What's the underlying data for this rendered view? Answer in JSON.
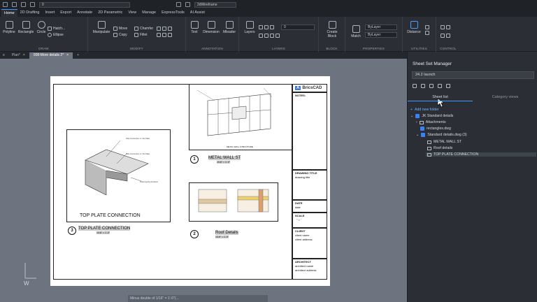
{
  "qat": {
    "layer_combo": "0",
    "workspace_combo": "2dWireframe"
  },
  "menu_tabs": [
    "Home",
    "2D Drafting",
    "Insert",
    "Export",
    "Annotate",
    "2D Parametric",
    "View",
    "Manage",
    "ExpressTools",
    "AI Assist"
  ],
  "ribbon": {
    "draw": {
      "title": "DRAW",
      "polyline": "Polyline",
      "rectangle": "Rectangle",
      "circle": "Circle",
      "hatch": "Hatch...",
      "ellipse": "Ellipse"
    },
    "modify": {
      "title": "MODIFY",
      "manipulate": "Manipulate",
      "move": "Move",
      "copy": "Copy",
      "chamfer": "Chamfer",
      "fillet": "Fillet"
    },
    "annotation": {
      "title": "ANNOTATION",
      "text": "Text",
      "dimension": "Dimension",
      "mleader": "Mleader"
    },
    "layers": {
      "title": "LAYERS",
      "layers": "Layers",
      "layer_value": "0"
    },
    "block": {
      "title": "BLOCK",
      "create": "Create",
      "block": "Block"
    },
    "properties": {
      "title": "PROPERTIES",
      "match": "Match",
      "color": "ByLayer",
      "linetype": "ByLayer"
    },
    "utilities": {
      "title": "UTILITIES",
      "distance": "Distance"
    },
    "control": {
      "title": "CONTROL"
    }
  },
  "doc_tabs": [
    "Plan*",
    "008-More details 2*"
  ],
  "sheet": {
    "brand": "BricsCAD",
    "notes": "NOTES:",
    "top_plate_title": "TOP PLATE CONNECTION",
    "tp_num": "3",
    "tp_label": "TOP PLATE CONNECTION",
    "tp_scale": "1/16\" = 1'-0\"",
    "metal_wall_caption": "METAL WALL STRUCTURE",
    "mw_num": "1",
    "mw_label": "METAL WALL ST",
    "mw_scale": "1/16\" = 1'-0\"",
    "roof_num": "2",
    "roof_label": "Roof Details",
    "roof_scale": "1/16\" = 1'-0\"",
    "drawing_title_h": "DRAWING TITLE",
    "drawing_title_v": "drawing title",
    "date_h": "DATE",
    "date_v": "date",
    "scale_h": "SCALE",
    "scale_v": "\" = '",
    "client_h": "CLIENT",
    "client_v1": "client name",
    "client_v2": "client address",
    "architect_h": "ARCHITECT",
    "architect_v1": "architect name",
    "architect_v2": "architect address",
    "tp_note1": "Side Connection on Top Plate",
    "tp_note2": "Side Connection on Top Plate",
    "tp_note3": "Plate bearing brackets"
  },
  "cmd_text": "Minus double of 1/16\" = 1'-0\"(...",
  "ssm": {
    "title": "Sheet Set Manager",
    "selected_set": "24.2 launch",
    "tab_sheet_list": "Sheet list",
    "tab_category": "Category views",
    "tree": {
      "add_new": "Add new folder",
      "root": "JK Standard details",
      "attachments": "Attachments",
      "rect": "rectangles.dwg",
      "std": "Standard details.dwg (3)",
      "s1": "METAL WALL ST",
      "s2": "Roof details",
      "s3": "TOP PLATE CONNECTION"
    }
  },
  "colors": {
    "accent": "#3b9cff",
    "panel": "#2b2f35",
    "canvas": "#6d7480"
  }
}
